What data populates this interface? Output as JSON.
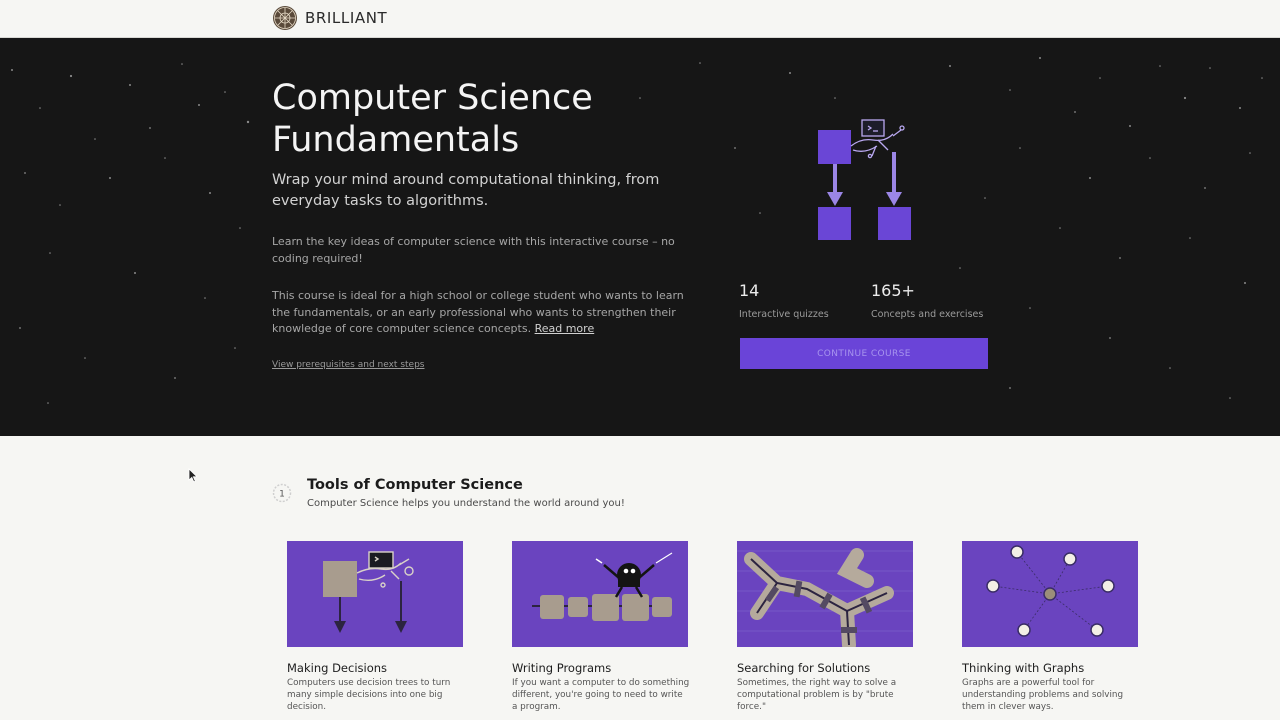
{
  "brand": {
    "name": "BRILLIANT"
  },
  "hero": {
    "title": "Computer Science Fundamentals",
    "subtitle": "Wrap your mind around computational thinking, from everyday tasks to algorithms.",
    "paragraph_1": "Learn the key ideas of computer science with this interactive course – no coding required!",
    "paragraph_2": "This course is ideal for a high school or college student who wants to learn the fundamentals, or an early professional who wants to strengthen their knowledge of core computer science concepts.",
    "read_more": "Read more",
    "prerequisites_link": "View prerequisites and next steps",
    "stats": [
      {
        "value": "14",
        "label": "Interactive quizzes"
      },
      {
        "value": "165+",
        "label": "Concepts and exercises"
      }
    ],
    "start_button": "CONTINUE COURSE"
  },
  "section": {
    "title": "Tools of Computer Science",
    "subtitle": "Computer Science helps you understand the world around you!"
  },
  "cards": [
    {
      "title": "Making Decisions",
      "description": "Computers use decision trees to turn many simple decisions into one big decision."
    },
    {
      "title": "Writing Programs",
      "description": "If you want a computer to do something different, you're going to need to write a program."
    },
    {
      "title": "Searching for Solutions",
      "description": "Sometimes, the right way to solve a computational problem is by \"brute force.\""
    },
    {
      "title": "Thinking with Graphs",
      "description": "Graphs are a powerful tool for understanding problems and solving them in clever ways."
    }
  ],
  "colors": {
    "accent": "#6a44d8",
    "card_background": "#6a44bf",
    "hero_background": "#161616",
    "page_background": "#f6f6f3"
  }
}
